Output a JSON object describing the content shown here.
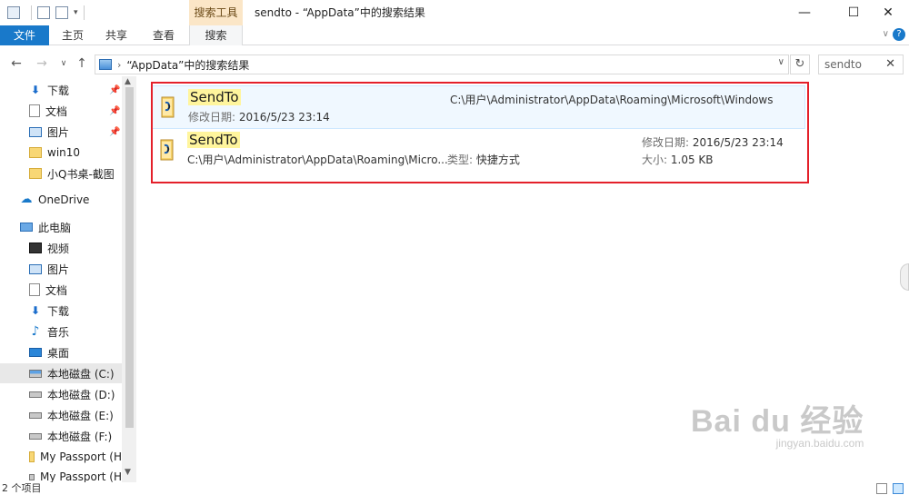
{
  "window": {
    "title": "sendto - “AppData”中的搜索结果",
    "context_tab": "搜索工具",
    "controls": {
      "minimize": "—",
      "maximize": "☐",
      "close": "✕"
    }
  },
  "ribbon": {
    "tabs": [
      "文件",
      "主页",
      "共享",
      "查看",
      "搜索"
    ],
    "expand_icon": "chevron-down-icon",
    "help_label": "?"
  },
  "address": {
    "path": "“AppData”中的搜索结果",
    "search_value": "sendto",
    "clear_label": "✕"
  },
  "sidebar": {
    "items": [
      {
        "label": "下载",
        "icon": "download-icon",
        "pinned": true
      },
      {
        "label": "文档",
        "icon": "document-icon",
        "pinned": true
      },
      {
        "label": "图片",
        "icon": "pictures-icon",
        "pinned": true
      },
      {
        "label": "win10",
        "icon": "folder-icon"
      },
      {
        "label": "小Q书桌-截图",
        "icon": "folder-icon"
      },
      {
        "label": "OneDrive",
        "icon": "onedrive-icon"
      },
      {
        "label": "此电脑",
        "icon": "this-pc-icon"
      },
      {
        "label": "视频",
        "icon": "videos-icon"
      },
      {
        "label": "图片",
        "icon": "pictures-icon"
      },
      {
        "label": "文档",
        "icon": "document-icon"
      },
      {
        "label": "下载",
        "icon": "download-icon"
      },
      {
        "label": "音乐",
        "icon": "music-icon"
      },
      {
        "label": "桌面",
        "icon": "desktop-icon"
      },
      {
        "label": "本地磁盘 (C:)",
        "icon": "system-drive-icon",
        "selected": true
      },
      {
        "label": "本地磁盘 (D:)",
        "icon": "drive-icon"
      },
      {
        "label": "本地磁盘 (E:)",
        "icon": "drive-icon"
      },
      {
        "label": "本地磁盘 (F:)",
        "icon": "drive-icon"
      },
      {
        "label": "My Passport (H",
        "icon": "folder-icon"
      },
      {
        "label": "My Passport (H",
        "icon": "drive-icon"
      }
    ]
  },
  "results": [
    {
      "name": "SendTo",
      "path": "C:\\用户\\Administrator\\AppData\\Roaming\\Microsoft\\Windows",
      "modified_label": "修改日期:",
      "modified": "2016/5/23 23:14"
    },
    {
      "name": "SendTo",
      "path": "C:\\用户\\Administrator\\AppData\\Roaming\\Micro...",
      "type_label": "类型:",
      "type": "快捷方式",
      "modified_label": "修改日期:",
      "modified": "2016/5/23 23:14",
      "size_label": "大小:",
      "size": "1.05 KB"
    }
  ],
  "status": {
    "count": "2 个项目"
  },
  "watermark": {
    "brand": "Bai du 经验",
    "sub": "jingyan.baidu.com"
  }
}
